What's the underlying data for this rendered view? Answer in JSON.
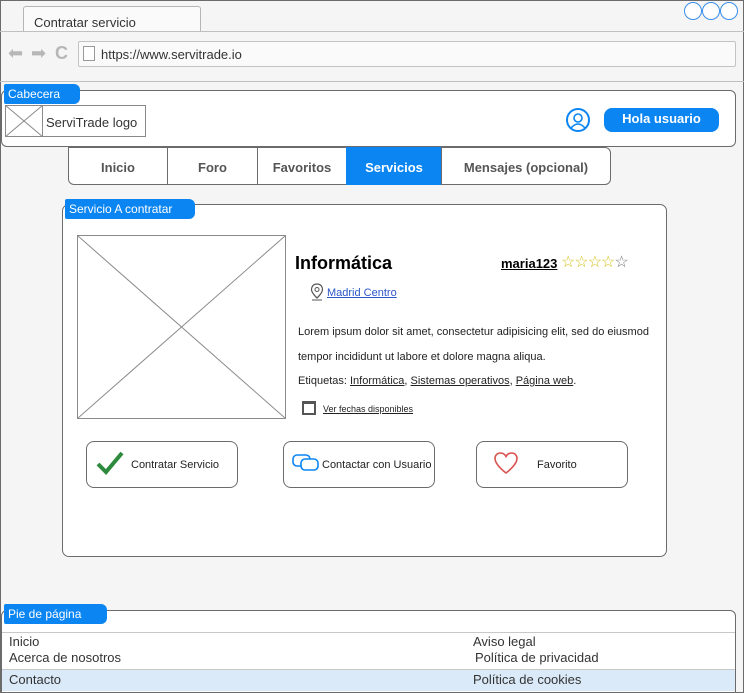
{
  "browser": {
    "tab_title": "Contratar servicio",
    "url": "https://www.servitrade.io"
  },
  "header": {
    "tag": "Cabecera",
    "logo_text": "ServiTrade logo",
    "user_button": "Hola usuario"
  },
  "nav": {
    "items": [
      "Inicio",
      "Foro",
      "Favoritos",
      "Servicios",
      "Mensajes (opcional)"
    ],
    "active": "Servicios"
  },
  "service": {
    "tag": "Servicio A contratar",
    "title": "Informática",
    "seller": "maria123",
    "rating": 4,
    "rating_max": 5,
    "location": "Madrid Centro ",
    "description": "Lorem ipsum dolor sit amet, consectetur adipisicing elit, sed do eiusmod tempor incididunt ut labore et dolore magna aliqua.",
    "tags_label": "Etiquetas: ",
    "tags": [
      "Informática",
      "Sistemas operativos",
      "Página web"
    ],
    "dates_link": "Ver fechas disponibles",
    "buttons": {
      "hire": "Contratar Servicio",
      "contact": "Contactar con Usuario",
      "favorite": "Favorito"
    }
  },
  "footer": {
    "tag": "Pie de página",
    "left_links": [
      "Inicio",
      "Acerca de nosotros",
      "Contacto"
    ],
    "right_links": [
      "Aviso legal",
      "Política de privacidad",
      "Política de cookies"
    ]
  },
  "colors": {
    "accent": "#0a85f2",
    "check": "#2e8b3e",
    "heart": "#d9534f",
    "star": "#d2c21f"
  }
}
